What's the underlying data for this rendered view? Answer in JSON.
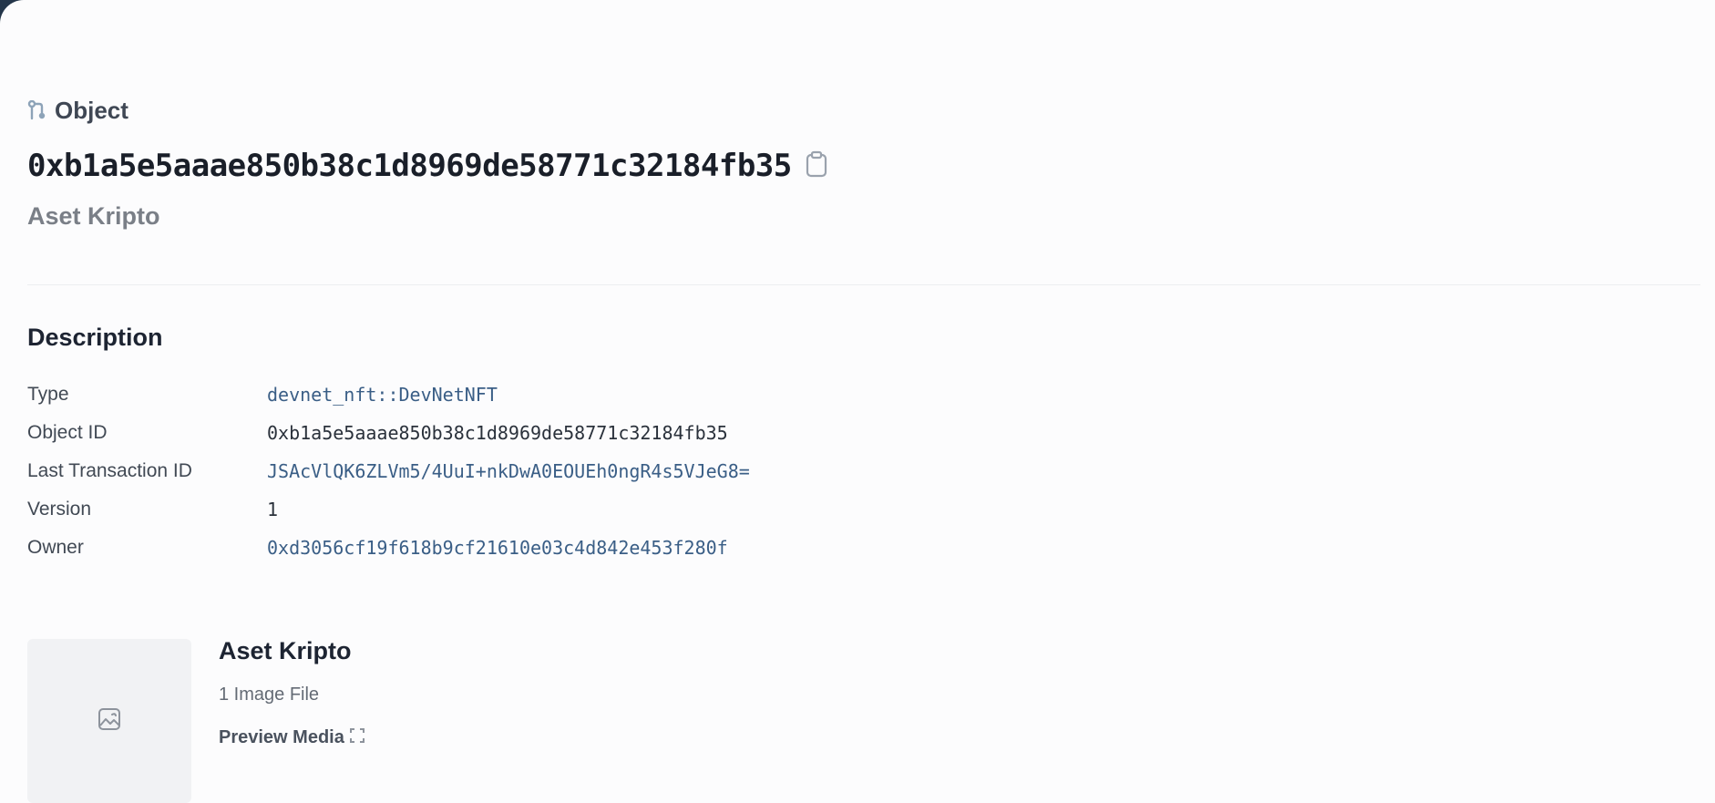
{
  "header": {
    "kind_label": "Object",
    "kind_icon": "object-link-icon",
    "object_id": "0xb1a5e5aaae850b38c1d8969de58771c32184fb35",
    "copy_icon": "clipboard-icon",
    "subtitle": "Aset Kripto"
  },
  "description": {
    "title": "Description",
    "rows": [
      {
        "key": "Type",
        "value": "devnet_nft::DevNetNFT"
      },
      {
        "key": "Object ID",
        "value": "0xb1a5e5aaae850b38c1d8969de58771c32184fb35"
      },
      {
        "key": "Last Transaction ID",
        "value": "JSAcVlQK6ZLVm5/4UuI+nkDwA0EOUEh0ngR4s5VJeG8="
      },
      {
        "key": "Version",
        "value": "1"
      },
      {
        "key": "Owner",
        "value": "0xd3056cf19f618b9cf21610e03c4d842e453f280f"
      }
    ]
  },
  "media": {
    "thumbnail_icon": "image-icon",
    "title": "Aset Kripto",
    "file_count": "1 Image File",
    "preview_label": "Preview Media",
    "preview_icon": "fullscreen-icon"
  },
  "colors": {
    "background_frame": "#24364a",
    "panel": "#fcfcfd",
    "link": "#3a5e86",
    "heading": "#1d2432",
    "muted": "#7a7f87"
  }
}
